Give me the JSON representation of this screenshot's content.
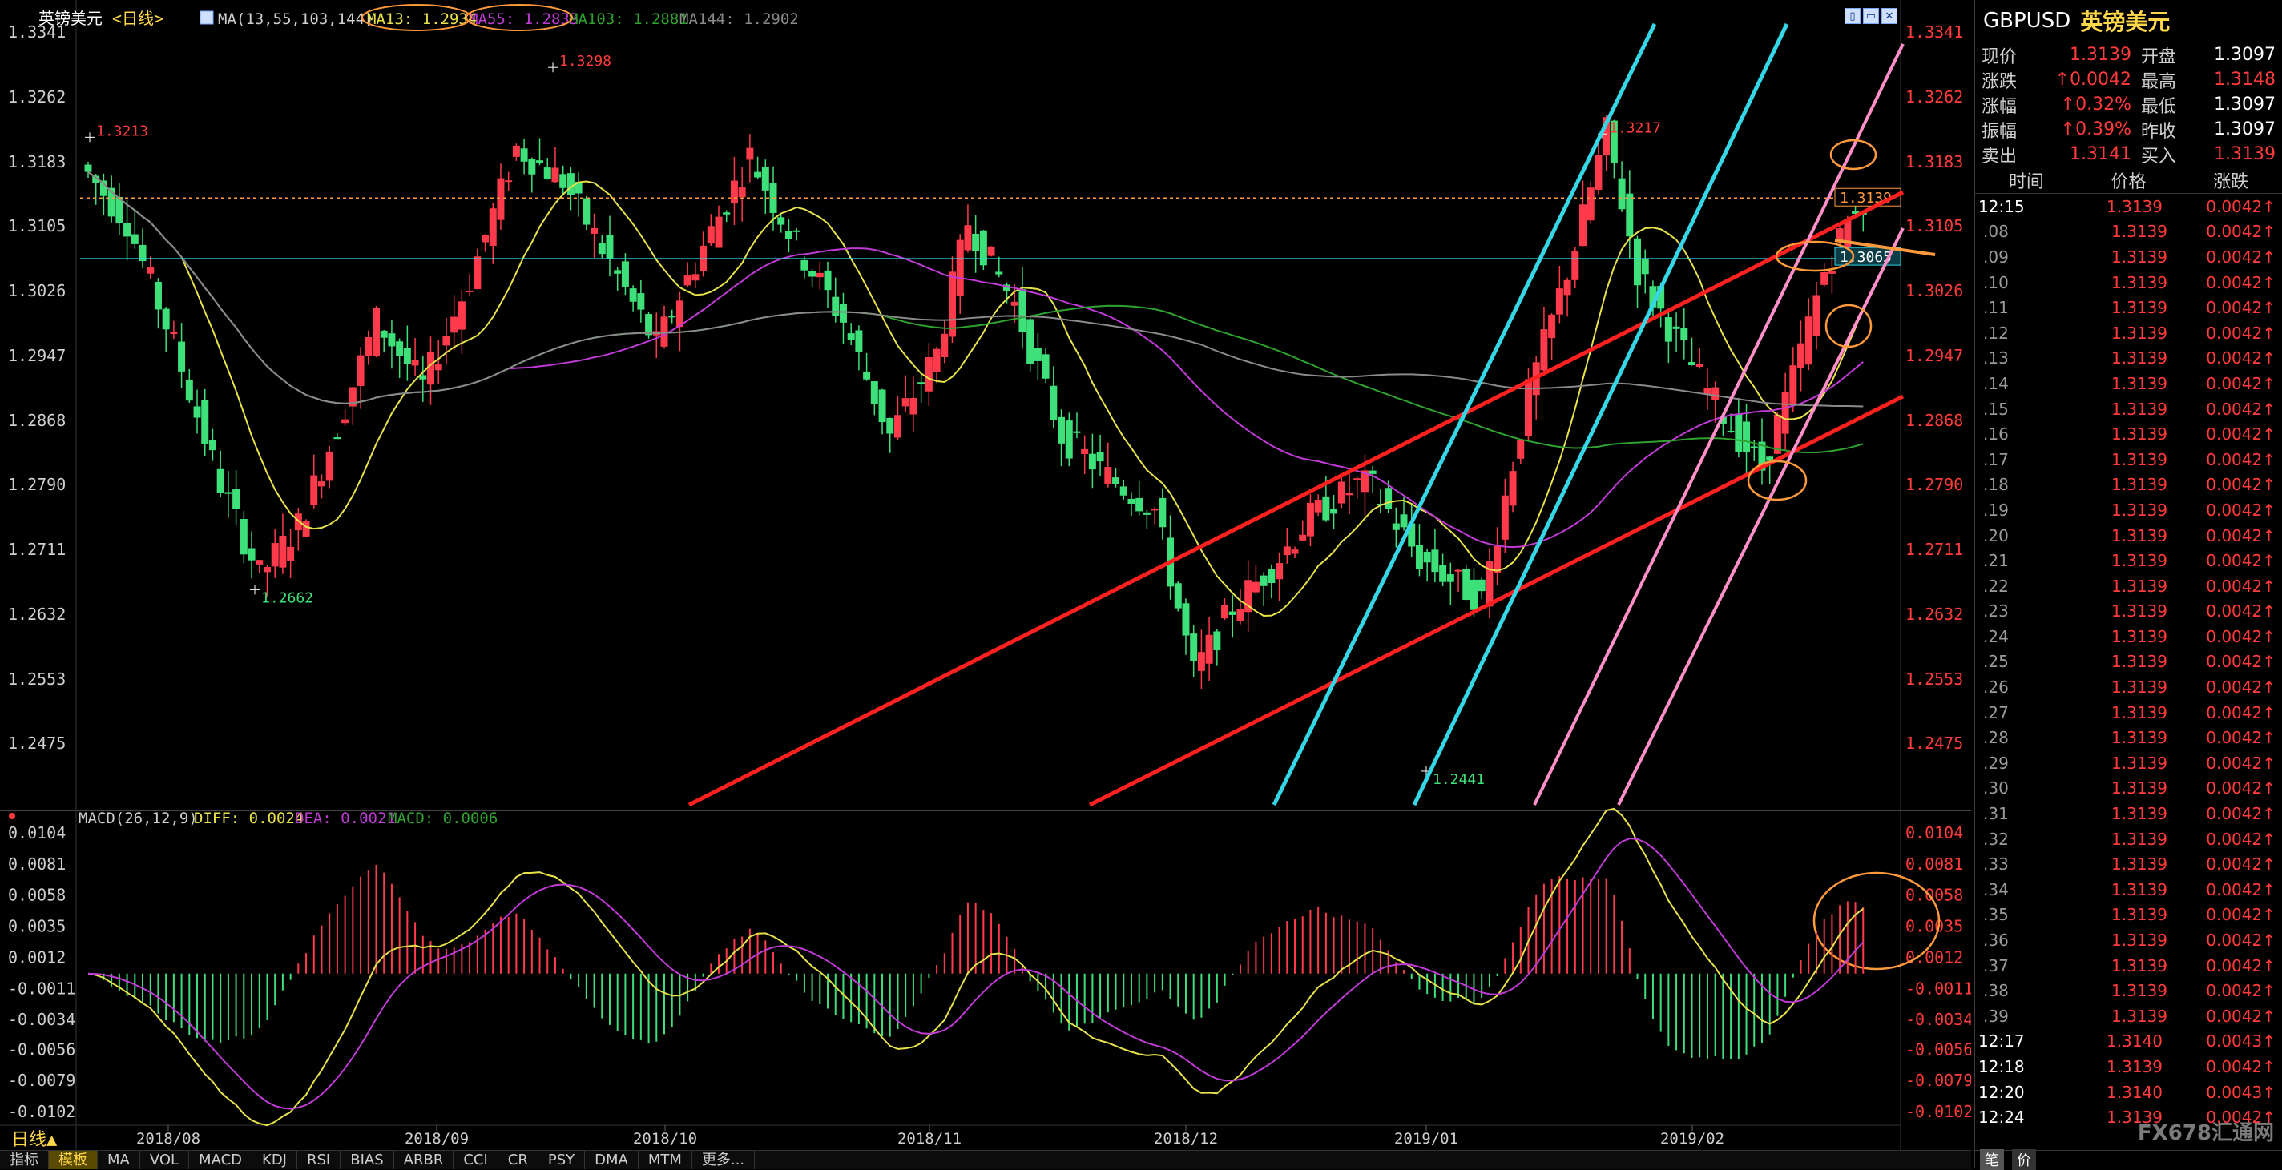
{
  "chart_header": {
    "symbol": "英镑美元",
    "period": "<日线>",
    "ma_label": "MA(13,55,103,144)",
    "ma13": "MA13: 1.2934",
    "ma55": "MA55: 1.2833",
    "ma103": "MA103: 1.2881",
    "ma144": "MA144: 1.2902"
  },
  "macd_header": {
    "label": "MACD(26,12,9)",
    "diff": "DIFF: 0.0024",
    "dea": "DEA: 0.0021",
    "macd": "MACD: 0.0006"
  },
  "window_buttons": [
    "▯",
    "▭",
    "✕"
  ],
  "price_axis": [
    "1.3341",
    "1.3262",
    "1.3183",
    "1.3105",
    "1.3026",
    "1.2947",
    "1.2868",
    "1.2790",
    "1.2711",
    "1.2632",
    "1.2553",
    "1.2475"
  ],
  "macd_axis": [
    "0.0104",
    "0.0081",
    "0.0058",
    "0.0035",
    "0.0012",
    "-0.0011",
    "-0.0034",
    "-0.0056",
    "-0.0079",
    "-0.0102"
  ],
  "date_labels": [
    "2018/08",
    "2018/09",
    "2018/10",
    "2018/11",
    "2018/12",
    "2019/01",
    "2019/02"
  ],
  "period_indicator": "日线▲",
  "bottom_tabs": [
    "指标",
    "模板",
    "MA",
    "VOL",
    "MACD",
    "KDJ",
    "RSI",
    "BIAS",
    "ARBR",
    "CCI",
    "CR",
    "PSY",
    "DMA",
    "MTM",
    "更多..."
  ],
  "chart_data": {
    "type": "candlestick",
    "annotations": [
      {
        "text": "1.3213",
        "value": 1.3213
      },
      {
        "text": "1.2662",
        "value": 1.2662
      },
      {
        "text": "1.3298",
        "value": 1.3298
      },
      {
        "text": "1.3217",
        "value": 1.3217
      },
      {
        "text": "1.2441",
        "value": 1.2441
      }
    ],
    "last_price_tag": "1.3139",
    "hline_tag": "1.3065",
    "hline_value": 1.3065,
    "last_price_value": 1.3139,
    "price_range": [
      1.24,
      1.3345
    ],
    "macd_range": [
      -0.0115,
      0.0104
    ],
    "colors": {
      "up": "#ff3a4a",
      "down": "#3ee07a",
      "ma13": "#e8e24a",
      "ma55": "#c03ad6",
      "ma103": "#2fa12f",
      "ma144": "#8a8a8a",
      "diff": "#e8e24a",
      "dea": "#c03ad6"
    }
  },
  "panel": {
    "code": "GBPUSD",
    "name": "英镑美元",
    "quotes": [
      {
        "l1": "现价",
        "v1": "1.3139",
        "l2": "开盘",
        "v2": "1.3097",
        "v2c": "white"
      },
      {
        "l1": "涨跌",
        "v1": "↑0.0042",
        "l2": "最高",
        "v2": "1.3148",
        "v2c": "red"
      },
      {
        "l1": "涨幅",
        "v1": "↑0.32%",
        "l2": "最低",
        "v2": "1.3097",
        "v2c": "white"
      },
      {
        "l1": "振幅",
        "v1": "↑0.39%",
        "l2": "昨收",
        "v2": "1.3097",
        "v2c": "white"
      },
      {
        "l1": "卖出",
        "v1": "1.3141",
        "l2": "买入",
        "v2": "1.3139",
        "v2c": "red"
      }
    ],
    "table_head": [
      "时间",
      "价格",
      "涨跌"
    ],
    "ticks": [
      {
        "t": "12:15",
        "p": "1.3139",
        "c": "0.0042↑",
        "full": true
      },
      {
        "t": ".08",
        "p": "1.3139",
        "c": "0.0042↑"
      },
      {
        "t": ".09",
        "p": "1.3139",
        "c": "0.0042↑"
      },
      {
        "t": ".10",
        "p": "1.3139",
        "c": "0.0042↑"
      },
      {
        "t": ".11",
        "p": "1.3139",
        "c": "0.0042↑"
      },
      {
        "t": ".12",
        "p": "1.3139",
        "c": "0.0042↑"
      },
      {
        "t": ".13",
        "p": "1.3139",
        "c": "0.0042↑"
      },
      {
        "t": ".14",
        "p": "1.3139",
        "c": "0.0042↑"
      },
      {
        "t": ".15",
        "p": "1.3139",
        "c": "0.0042↑"
      },
      {
        "t": ".16",
        "p": "1.3139",
        "c": "0.0042↑"
      },
      {
        "t": ".17",
        "p": "1.3139",
        "c": "0.0042↑"
      },
      {
        "t": ".18",
        "p": "1.3139",
        "c": "0.0042↑"
      },
      {
        "t": ".19",
        "p": "1.3139",
        "c": "0.0042↑"
      },
      {
        "t": ".20",
        "p": "1.3139",
        "c": "0.0042↑"
      },
      {
        "t": ".21",
        "p": "1.3139",
        "c": "0.0042↑"
      },
      {
        "t": ".22",
        "p": "1.3139",
        "c": "0.0042↑"
      },
      {
        "t": ".23",
        "p": "1.3139",
        "c": "0.0042↑"
      },
      {
        "t": ".24",
        "p": "1.3139",
        "c": "0.0042↑"
      },
      {
        "t": ".25",
        "p": "1.3139",
        "c": "0.0042↑"
      },
      {
        "t": ".26",
        "p": "1.3139",
        "c": "0.0042↑"
      },
      {
        "t": ".27",
        "p": "1.3139",
        "c": "0.0042↑"
      },
      {
        "t": ".28",
        "p": "1.3139",
        "c": "0.0042↑"
      },
      {
        "t": ".29",
        "p": "1.3139",
        "c": "0.0042↑"
      },
      {
        "t": ".30",
        "p": "1.3139",
        "c": "0.0042↑"
      },
      {
        "t": ".31",
        "p": "1.3139",
        "c": "0.0042↑"
      },
      {
        "t": ".32",
        "p": "1.3139",
        "c": "0.0042↑"
      },
      {
        "t": ".33",
        "p": "1.3139",
        "c": "0.0042↑"
      },
      {
        "t": ".34",
        "p": "1.3139",
        "c": "0.0042↑"
      },
      {
        "t": ".35",
        "p": "1.3139",
        "c": "0.0042↑"
      },
      {
        "t": ".36",
        "p": "1.3139",
        "c": "0.0042↑"
      },
      {
        "t": ".37",
        "p": "1.3139",
        "c": "0.0042↑"
      },
      {
        "t": ".38",
        "p": "1.3139",
        "c": "0.0042↑"
      },
      {
        "t": ".39",
        "p": "1.3139",
        "c": "0.0042↑"
      },
      {
        "t": "12:17",
        "p": "1.3140",
        "c": "0.0043↑",
        "full": true
      },
      {
        "t": "12:18",
        "p": "1.3139",
        "c": "0.0042↑",
        "full": true
      },
      {
        "t": "12:20",
        "p": "1.3140",
        "c": "0.0043↑",
        "full": true
      },
      {
        "t": "12:24",
        "p": "1.3139",
        "c": "0.0042↑",
        "full": true
      }
    ],
    "foot_tabs": [
      "笔",
      "价"
    ],
    "brand": "FX678汇通网"
  }
}
